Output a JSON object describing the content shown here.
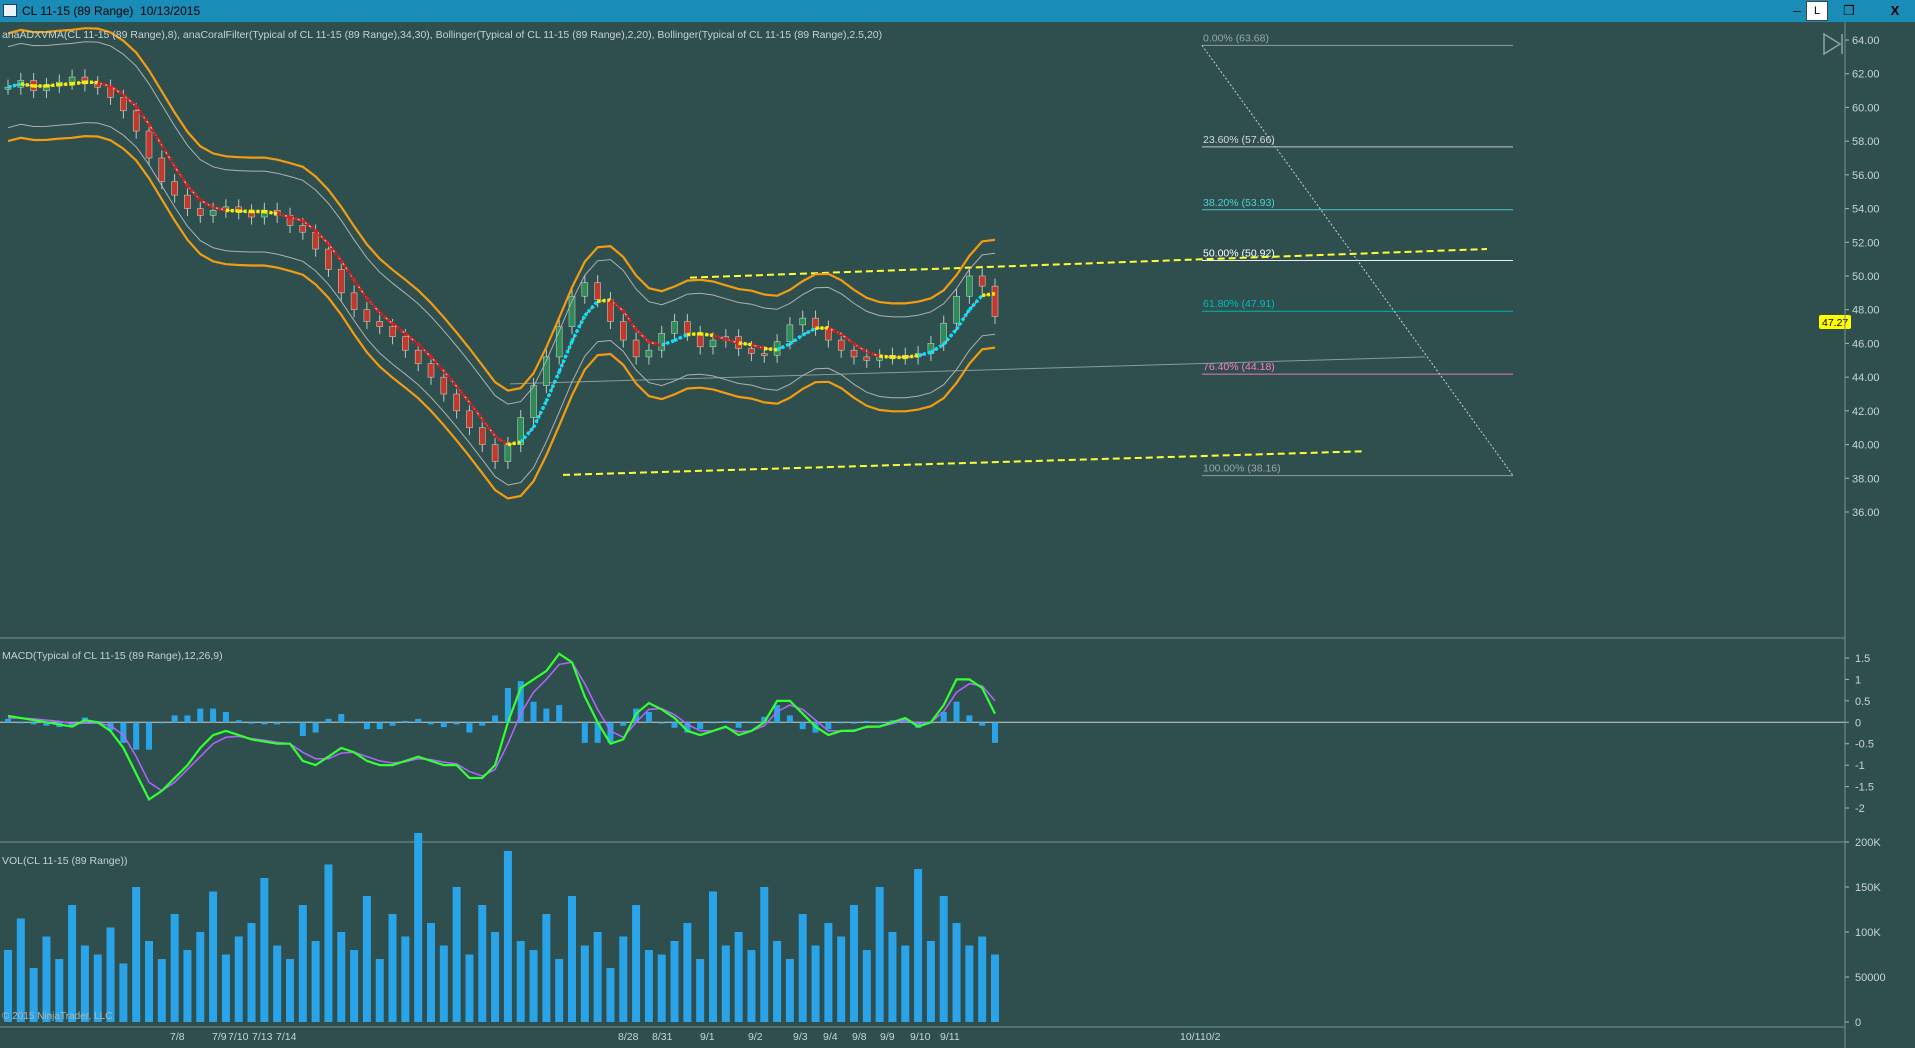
{
  "window": {
    "title": "CL 11-15 (89 Range)  10/13/2015",
    "buttons": {
      "minimize": "–",
      "link": "L",
      "restore": "❐",
      "close": "X"
    }
  },
  "panels": {
    "price_label": "anaADXVMA(CL 11-15 (89 Range),8), anaCoralFilter(Typical of CL 11-15 (89 Range),34,30), Bollinger(Typical of CL 11-15 (89 Range),2,20), Bollinger(Typical of CL 11-15 (89 Range),2.5,20)",
    "macd_label": "MACD(Typical of CL 11-15 (89 Range),12,26,9)",
    "vol_label": "VOL(CL 11-15 (89 Range))",
    "copyright": "© 2015 NinjaTrader, LLC"
  },
  "colors": {
    "background": "#2f4f4f",
    "candle_up": "#2e8b57",
    "candle_down": "#c0392b",
    "bollinger": "#f39c12",
    "adxvma_down": "#d21f1f",
    "adxvma_flat": "#f2f200",
    "adxvma_up": "#00e5ff",
    "coral": "#ff9f9f",
    "macd": "#33ff33",
    "signal": "#b266ff",
    "histogram": "#2aa4e8",
    "volume": "#2aa4e8",
    "trendline": "#ffff33",
    "last_price": "#ffff00"
  },
  "chart_data": [
    {
      "type": "line",
      "name": "price",
      "y_ticks": [
        "64.00",
        "62.00",
        "60.00",
        "58.00",
        "56.00",
        "54.00",
        "52.00",
        "50.00",
        "48.00",
        "46.00",
        "44.00",
        "42.00",
        "40.00",
        "38.00",
        "36.00"
      ],
      "ylim": [
        35.5,
        64.5
      ],
      "last_price": "47.27",
      "last_price_value": 47.27,
      "x_ticks": [
        "7/8",
        "7/9",
        "7/10",
        "7/13",
        "7/14",
        "8/28",
        "8/31",
        "9/1",
        "9/2",
        "9/3",
        "9/4",
        "9/8",
        "9/9",
        "9/10",
        "9/11",
        "10/1",
        "10/2"
      ],
      "close": [
        61.2,
        61.6,
        61.0,
        61.3,
        61.5,
        61.8,
        61.4,
        61.2,
        60.6,
        59.8,
        58.6,
        57.0,
        55.6,
        54.8,
        54.0,
        53.6,
        53.9,
        54.1,
        53.8,
        53.5,
        53.9,
        53.6,
        53.0,
        52.6,
        51.6,
        50.4,
        49.0,
        48.0,
        47.3,
        47.0,
        46.4,
        45.6,
        44.8,
        44.0,
        43.0,
        42.0,
        41.0,
        40.0,
        39.0,
        40.0,
        41.6,
        43.5,
        45.2,
        47.0,
        48.8,
        49.6,
        48.6,
        47.3,
        46.2,
        45.2,
        45.6,
        46.6,
        47.3,
        46.6,
        45.8,
        46.2,
        46.4,
        45.7,
        45.4,
        45.3,
        46.1,
        47.1,
        47.5,
        46.9,
        46.2,
        45.6,
        45.2,
        45.0,
        45.2,
        45.3,
        45.2,
        45.4,
        46.0,
        47.2,
        48.8,
        50.0,
        49.4,
        47.6
      ],
      "fibonacci": [
        {
          "label": "0.00% (63.68)",
          "value": 63.68,
          "color": "#9aa6a6"
        },
        {
          "label": "23.60% (57.66)",
          "value": 57.66,
          "color": "#d8d8d8"
        },
        {
          "label": "38.20% (53.93)",
          "value": 53.93,
          "color": "#4fd0d0"
        },
        {
          "label": "50.00% (50.92)",
          "value": 50.92,
          "color": "#ffffff"
        },
        {
          "label": "61.80% (47.91)",
          "value": 47.91,
          "color": "#00bcbc"
        },
        {
          "label": "76.40% (44.18)",
          "value": 44.18,
          "color": "#ff7ad0"
        },
        {
          "label": "100.00% (38.16)",
          "value": 38.16,
          "color": "#9aa6a6"
        }
      ]
    },
    {
      "type": "line",
      "name": "MACD",
      "y_ticks": [
        "1.5",
        "1",
        "0.5",
        "0",
        "-0.5",
        "-1",
        "-1.5",
        "-2"
      ],
      "ylim": [
        -2.2,
        1.75
      ],
      "macd": [
        0.15,
        0.1,
        0.05,
        0.0,
        -0.05,
        -0.1,
        0.05,
        0.0,
        -0.2,
        -0.6,
        -1.2,
        -1.8,
        -1.6,
        -1.3,
        -1.0,
        -0.6,
        -0.3,
        -0.2,
        -0.3,
        -0.4,
        -0.45,
        -0.5,
        -0.5,
        -0.9,
        -1.0,
        -0.8,
        -0.6,
        -0.7,
        -0.9,
        -1.0,
        -1.0,
        -0.9,
        -0.8,
        -0.9,
        -1.0,
        -1.0,
        -1.3,
        -1.3,
        -1.0,
        0.0,
        0.8,
        1.0,
        1.2,
        1.6,
        1.4,
        0.6,
        0.0,
        -0.5,
        -0.4,
        0.2,
        0.45,
        0.3,
        0.1,
        -0.2,
        -0.3,
        -0.2,
        -0.1,
        -0.3,
        -0.2,
        0.0,
        0.5,
        0.5,
        0.2,
        -0.1,
        -0.3,
        -0.2,
        -0.2,
        -0.1,
        -0.1,
        0.0,
        0.1,
        -0.1,
        0.0,
        0.4,
        1.0,
        1.0,
        0.8,
        0.2
      ],
      "signal": [
        0.1,
        0.1,
        0.08,
        0.05,
        0.02,
        -0.03,
        -0.02,
        -0.02,
        -0.08,
        -0.3,
        -0.8,
        -1.4,
        -1.6,
        -1.4,
        -1.1,
        -0.8,
        -0.5,
        -0.35,
        -0.33,
        -0.38,
        -0.42,
        -0.47,
        -0.5,
        -0.7,
        -0.85,
        -0.85,
        -0.72,
        -0.7,
        -0.8,
        -0.9,
        -0.95,
        -0.92,
        -0.85,
        -0.87,
        -0.93,
        -0.97,
        -1.15,
        -1.25,
        -1.1,
        -0.5,
        0.2,
        0.7,
        1.0,
        1.35,
        1.4,
        0.9,
        0.3,
        -0.2,
        -0.35,
        0.0,
        0.3,
        0.32,
        0.18,
        -0.05,
        -0.2,
        -0.2,
        -0.12,
        -0.22,
        -0.2,
        -0.08,
        0.25,
        0.4,
        0.3,
        0.05,
        -0.2,
        -0.2,
        -0.18,
        -0.12,
        -0.1,
        -0.03,
        0.05,
        -0.02,
        0.0,
        0.25,
        0.7,
        0.9,
        0.85,
        0.5
      ]
    },
    {
      "type": "bar",
      "name": "VOL",
      "y_ticks": [
        "200K",
        "150K",
        "100K",
        "50000",
        "0"
      ],
      "ylim": [
        0,
        215000
      ],
      "volume": [
        80000,
        115000,
        60000,
        95000,
        70000,
        130000,
        85000,
        75000,
        105000,
        65000,
        150000,
        90000,
        70000,
        120000,
        80000,
        100000,
        145000,
        75000,
        95000,
        110000,
        160000,
        85000,
        70000,
        130000,
        90000,
        175000,
        100000,
        80000,
        140000,
        70000,
        120000,
        95000,
        210000,
        110000,
        85000,
        150000,
        75000,
        130000,
        100000,
        190000,
        90000,
        80000,
        120000,
        70000,
        140000,
        85000,
        100000,
        60000,
        95000,
        130000,
        80000,
        75000,
        90000,
        110000,
        70000,
        145000,
        85000,
        100000,
        80000,
        150000,
        90000,
        70000,
        120000,
        85000,
        110000,
        95000,
        130000,
        80000,
        150000,
        100000,
        85000,
        170000,
        90000,
        140000,
        110000,
        85000,
        95000,
        75000
      ]
    }
  ]
}
